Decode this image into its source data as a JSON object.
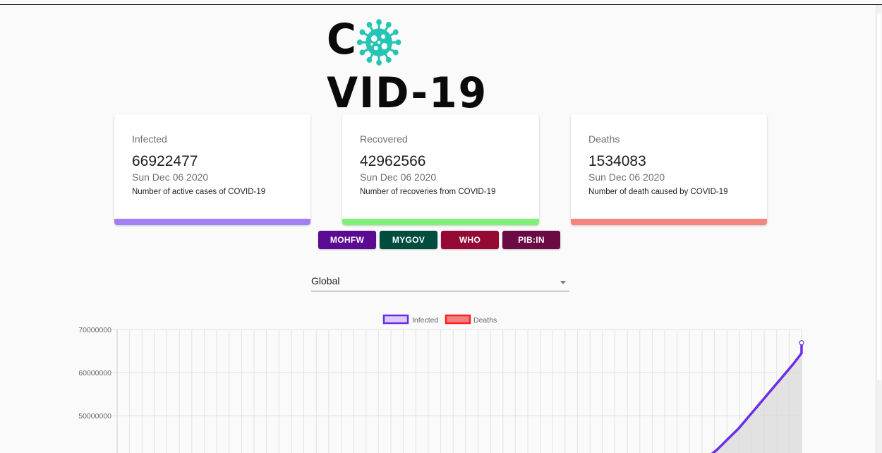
{
  "app": {
    "logo_left": "C",
    "logo_right": "VID-19",
    "logo_icon": "virus-icon",
    "logo_icon_color": "#26c4b4"
  },
  "cards": [
    {
      "label": "Infected",
      "value": "66922477",
      "date": "Sun Dec 06 2020",
      "desc": "Number of active cases of COVID-19",
      "color": "#a27ff5"
    },
    {
      "label": "Recovered",
      "value": "42962566",
      "date": "Sun Dec 06 2020",
      "desc": "Number of recoveries from COVID-19",
      "color": "#80f07a"
    },
    {
      "label": "Deaths",
      "value": "1534083",
      "date": "Sun Dec 06 2020",
      "desc": "Number of death caused by COVID-19",
      "color": "#f5857e"
    }
  ],
  "sources": [
    {
      "label": "MOHFW",
      "color": "#5b0a92"
    },
    {
      "label": "MYGOV",
      "color": "#004d40"
    },
    {
      "label": "WHO",
      "color": "#950a35"
    },
    {
      "label": "PIB:IN",
      "color": "#6b0a45"
    }
  ],
  "region_select": {
    "value": "Global"
  },
  "chart_data": {
    "type": "line",
    "title": "",
    "xlabel": "",
    "ylabel": "",
    "ylim": [
      40000000,
      70000000
    ],
    "y_ticks": [
      "70000000",
      "60000000",
      "50000000"
    ],
    "grid": true,
    "legend": {
      "placement": "top-center"
    },
    "series": [
      {
        "name": "Infected",
        "color": "#6b2ee8",
        "fill": "#d9d9d9",
        "visible_points": [
          [
            0.86,
            40000000
          ],
          [
            0.876,
            42000000
          ],
          [
            0.892,
            44500000
          ],
          [
            0.908,
            47000000
          ],
          [
            0.924,
            50000000
          ],
          [
            0.94,
            53000000
          ],
          [
            0.956,
            56000000
          ],
          [
            0.972,
            59000000
          ],
          [
            0.988,
            62000000
          ],
          [
            1.0,
            64500000
          ],
          [
            1.0,
            66922477
          ]
        ]
      },
      {
        "name": "Deaths",
        "color": "#ff2020",
        "fill": "#f08080"
      }
    ]
  }
}
